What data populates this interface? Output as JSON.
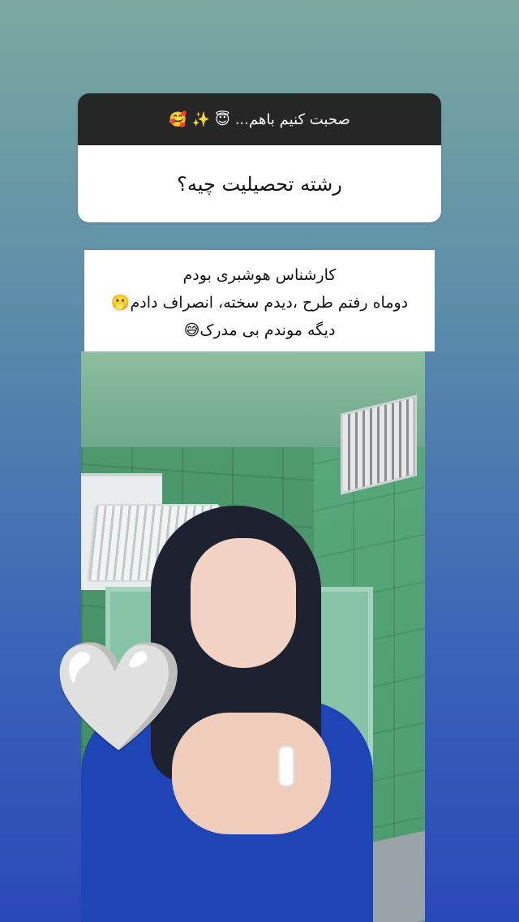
{
  "question_sticker": {
    "header_text": "صحبت کنیم باهم...",
    "header_emojis": [
      "😇",
      "✨",
      "🥰"
    ],
    "question": "رشته تحصیلیت چیه؟"
  },
  "answer": {
    "lines": [
      "کارشناس هوشبری بودم",
      "دوماه رفتم طرح ،دیدم سخته، انصراف دادم🫢",
      "دیگه موندم بی مدرک😅"
    ]
  },
  "sticker": {
    "heart_icon": "🤍"
  }
}
